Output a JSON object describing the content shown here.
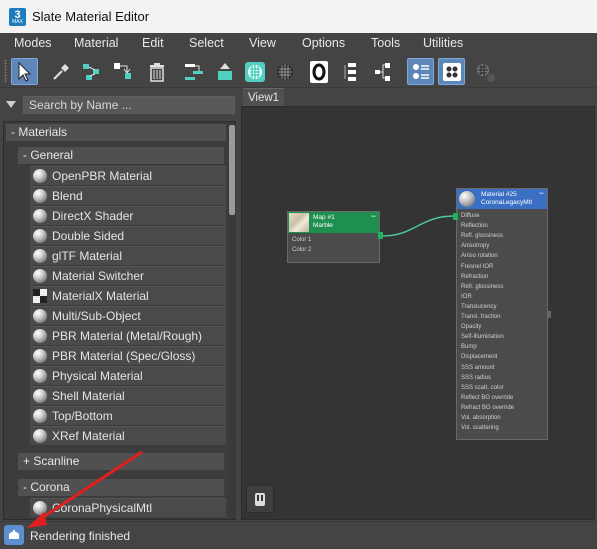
{
  "window": {
    "title": "Slate Material Editor",
    "app_icon_text": "3",
    "app_icon_sub": "MAX"
  },
  "menu": [
    "Modes",
    "Material",
    "Edit",
    "Select",
    "View",
    "Options",
    "Tools",
    "Utilities"
  ],
  "toolbar": {
    "buttons": [
      "select-tool",
      "pick-material",
      "put-to-scene",
      "assign-to-selection",
      "delete",
      "move-children",
      "hide-unused-slots",
      "show-shaded",
      "show-background",
      "material-id-zero",
      "show-end-result",
      "layout-children",
      "show-parameters",
      "show-nodes",
      "pick-from-object"
    ],
    "material_id_value": "0",
    "active_color": "#5f86b8"
  },
  "search": {
    "placeholder": "Search by Name ..."
  },
  "browser": {
    "materials_header": "- Materials",
    "general_header": "- General",
    "general_items": [
      "OpenPBR Material",
      "Blend",
      "DirectX Shader",
      "Double Sided",
      "glTF Material",
      "Material Switcher",
      "MaterialX Material",
      "Multi/Sub-Object",
      "PBR Material (Metal/Rough)",
      "PBR Material (Spec/Gloss)",
      "Physical Material",
      "Shell Material",
      "Top/Bottom",
      "XRef Material"
    ],
    "scanline_header": "+ Scanline",
    "corona_header": "- Corona",
    "corona_items": [
      "CoronaPhysicalMtl"
    ]
  },
  "view": {
    "tab_label": "View1",
    "map_node": {
      "title": "Map #1",
      "subtitle": "Marble",
      "ports": [
        "Color 1",
        "Color 2"
      ],
      "header_color": "#1f8f4f"
    },
    "material_node": {
      "title": "Material #25",
      "subtitle": "CoronaLegacyMtl",
      "header_color": "#3a6fc4",
      "ports": [
        "Diffuse",
        "Reflection",
        "Refl. glossiness",
        "Anisotropy",
        "Aniso rotation",
        "Fresnel IOR",
        "Refraction",
        "Refr. glossiness",
        "IOR",
        "Translucency",
        "Transl. fraction",
        "Opacity",
        "Self-Illumination",
        "Bump",
        "Displacement",
        "SSS amount",
        "SSS radius",
        "SSS scatt. color",
        "Reflect BG override",
        "Refract BG override",
        "Vol. absorption",
        "Vol. scattering"
      ]
    },
    "connection_color": "#4ec9a0"
  },
  "status": {
    "text": "Rendering finished"
  },
  "annotation": {
    "arrow_color": "#e02020"
  }
}
